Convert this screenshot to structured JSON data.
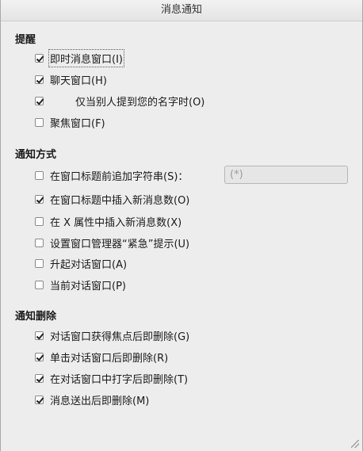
{
  "window": {
    "title": "消息通知"
  },
  "sections": {
    "remind": {
      "title": "提醒",
      "items": [
        {
          "label": "即时消息窗口(I)",
          "checked": true
        },
        {
          "label": "聊天窗口(H)",
          "checked": true
        },
        {
          "label": "仅当别人提到您的名字时(O)",
          "checked": true
        },
        {
          "label": "聚焦窗口(F)",
          "checked": false
        }
      ]
    },
    "method": {
      "title": "通知方式",
      "items": [
        {
          "label": "在窗口标题前追加字符串(S)：",
          "checked": false
        },
        {
          "label": "在窗口标题中插入新消息数(O)",
          "checked": true
        },
        {
          "label": "在 X 属性中插入新消息数(X)",
          "checked": false
        },
        {
          "label": "设置窗口管理器“紧急”提示(U)",
          "checked": false
        },
        {
          "label": "升起对话窗口(A)",
          "checked": false
        },
        {
          "label": "当前对话窗口(P)",
          "checked": false
        }
      ],
      "prefix_field_value": "(*)"
    },
    "remove": {
      "title": "通知删除",
      "items": [
        {
          "label": "对话窗口获得焦点后即删除(G)",
          "checked": true
        },
        {
          "label": "单击对话窗口后即删除(R)",
          "checked": true
        },
        {
          "label": "在对话窗口中打字后即删除(T)",
          "checked": true
        },
        {
          "label": "消息送出后即删除(M)",
          "checked": true
        }
      ]
    }
  }
}
